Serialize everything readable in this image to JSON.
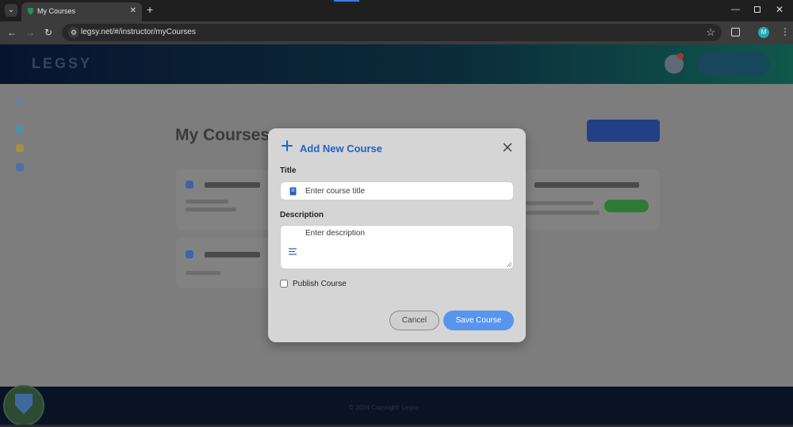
{
  "browser": {
    "tab_title": "My Courses",
    "url": "legsy.net/#/instructor/myCourses",
    "profile_initial": "M"
  },
  "modal": {
    "title": "Add New Course",
    "title_label": "Title",
    "title_placeholder": "Enter course title",
    "description_label": "Description",
    "description_placeholder": "Enter description",
    "publish_label": "Publish Course",
    "publish_checked": false,
    "cancel_label": "Cancel",
    "save_label": "Save Course"
  },
  "colors": {
    "accent": "#1e63c9",
    "save_button": "#5795ee"
  },
  "icons": {
    "add": "plus-icon",
    "close": "close-icon",
    "title_field": "book-icon",
    "description_field": "lines-icon"
  }
}
